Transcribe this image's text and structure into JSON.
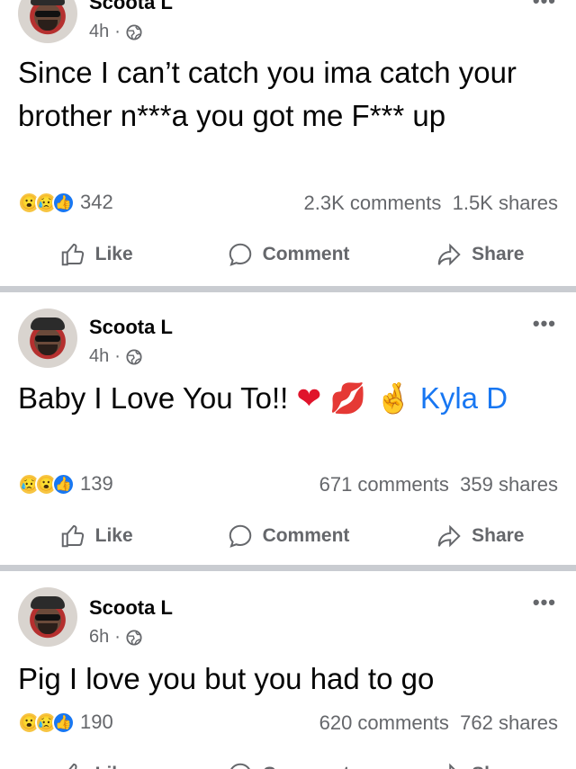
{
  "posts": [
    {
      "author": "Scoota L",
      "time": "4h",
      "text": "Since I can’t catch you ima catch your brother n***a you got me F*** up",
      "reaction_count": "342",
      "comments": "2.3K comments",
      "shares": "1.5K shares"
    },
    {
      "author": "Scoota L",
      "time": "4h",
      "text": "Baby I Love You To!!",
      "mention": "Kyla D",
      "reaction_count": "139",
      "comments": "671 comments",
      "shares": "359 shares"
    },
    {
      "author": "Scoota L",
      "time": "6h",
      "text": "Pig I love you but you had to go",
      "reaction_count": "190",
      "comments": "620 comments",
      "shares": "762 shares"
    }
  ],
  "actions": {
    "like": "Like",
    "comment": "Comment",
    "share": "Share"
  },
  "separators": {
    "dot": "·",
    "more": "•••"
  },
  "icons": [
    "more-icon",
    "globe-icon",
    "wow-reaction-icon",
    "sad-reaction-icon",
    "like-reaction-icon",
    "thumbs-up-icon",
    "comment-bubble-icon",
    "share-arrow-icon",
    "heart-emoji-icon",
    "kiss-mark-emoji-icon",
    "crossed-fingers-emoji-icon"
  ],
  "colors": {
    "mention": "#1877f2",
    "secondary_text": "#65676b",
    "separator": "#c9ccd1",
    "like_blue": "#1877f2",
    "heart": "#e0142b"
  }
}
